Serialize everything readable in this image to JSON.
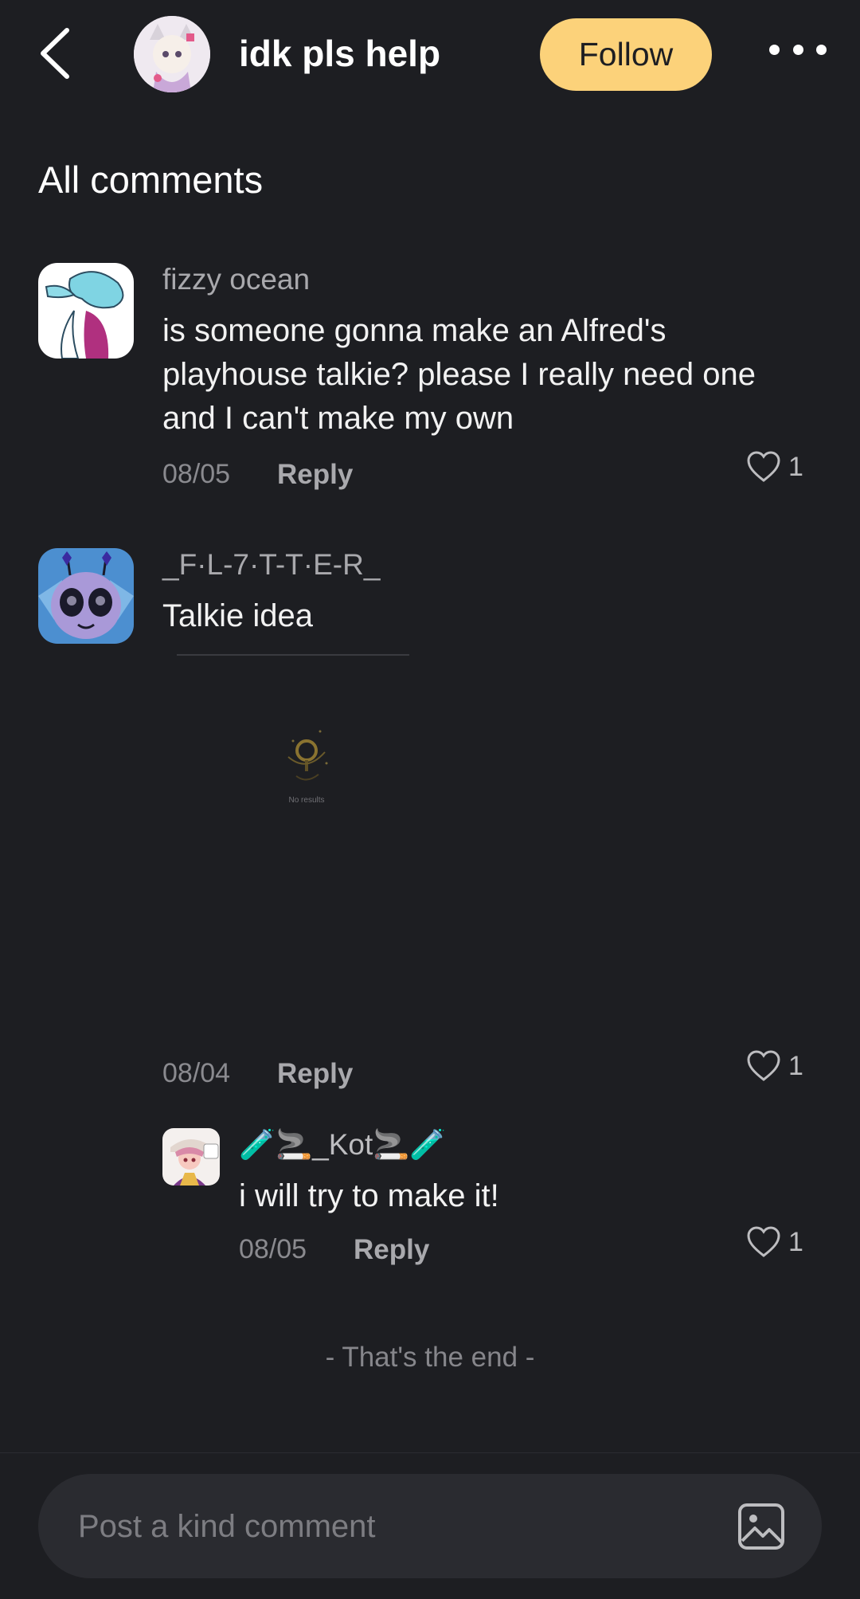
{
  "header": {
    "title": "idk pls help",
    "follow_label": "Follow"
  },
  "section_title": "All comments",
  "comments": [
    {
      "username": "fizzy ocean",
      "lines": [
        "is someone gonna make an Alfred's",
        "playhouse talkie? please I really need one",
        "and I can't make my own"
      ],
      "date": "08/05",
      "reply_label": "Reply",
      "likes": "1"
    },
    {
      "username": "_F·L-7·T-T·E-R_",
      "lines": [
        "Talkie idea"
      ],
      "date": "08/04",
      "reply_label": "Reply",
      "likes": "1",
      "embed": {
        "status": "No results"
      }
    }
  ],
  "reply": {
    "username": "🧪🚬_Kot🚬🧪",
    "text": "i will try to make it!",
    "date": "08/05",
    "reply_label": "Reply",
    "likes": "1"
  },
  "end_text": "- That's the end -",
  "composer": {
    "placeholder": "Post a kind comment"
  },
  "icons": {
    "back": "back-arrow-icon",
    "more": "more-dots-icon",
    "like": "heart-icon",
    "image": "image-icon",
    "no_results": "magnifier-icon"
  },
  "colors": {
    "background": "#1d1e22",
    "follow_button": "#fcd27a",
    "input_background": "#2a2b30"
  }
}
